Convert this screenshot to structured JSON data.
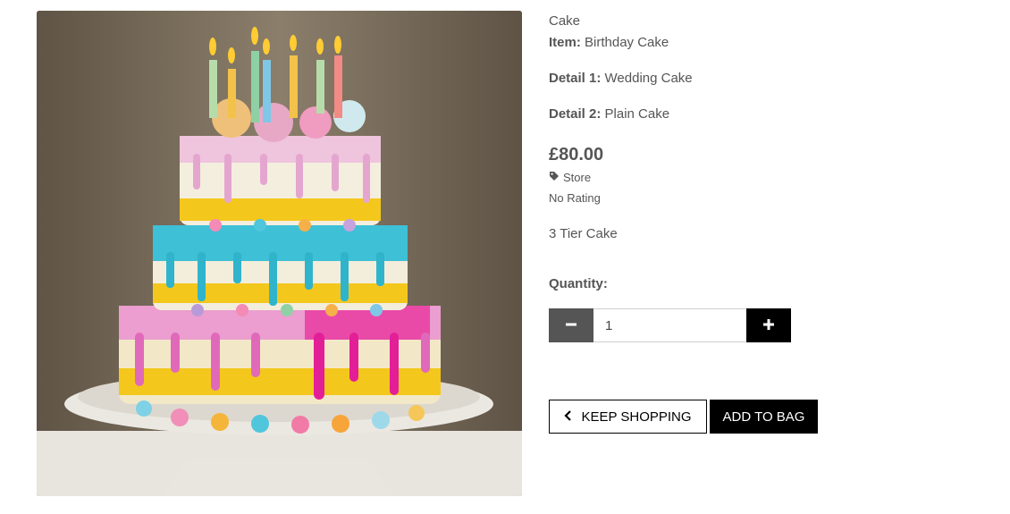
{
  "product": {
    "category": "Cake",
    "item_label": "Item:",
    "item_value": "Birthday Cake",
    "detail1_label": "Detail 1:",
    "detail1_value": "Wedding Cake",
    "detail2_label": "Detail 2:",
    "detail2_value": "Plain Cake",
    "price": "£80.00",
    "store_label": "Store",
    "store_icon": "tag-icon",
    "rating": "No Rating",
    "description": "3 Tier Cake",
    "image_alt": "cake-photo"
  },
  "quantity": {
    "label": "Quantity:",
    "value": "1",
    "decrement_icon": "minus-icon",
    "increment_icon": "plus-icon"
  },
  "actions": {
    "keep_shopping": "KEEP SHOPPING",
    "keep_shopping_icon": "chevron-left-icon",
    "add_to_bag": "ADD TO BAG"
  },
  "colors": {
    "minus_button": "#555555",
    "plus_button": "#000000",
    "add_button": "#000000",
    "text": "#555555"
  }
}
